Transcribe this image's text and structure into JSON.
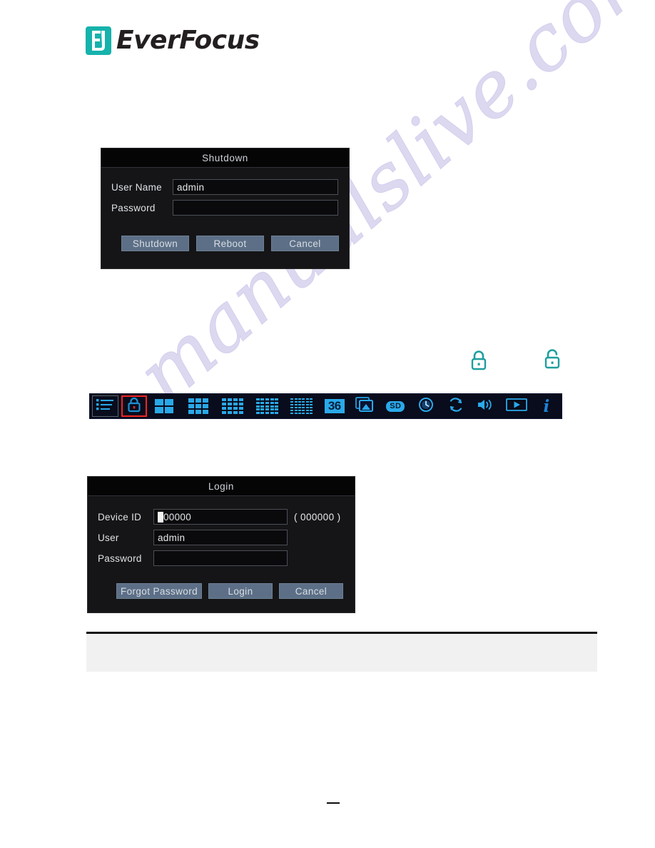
{
  "brand": {
    "name": "EverFocus",
    "logo_icon": "everfocus-f-mark",
    "accent_color": "#16b2ac",
    "text_color": "#231f20"
  },
  "watermark": {
    "text": "manualslive.com",
    "color": "#d7d2ee"
  },
  "shutdown_dialog": {
    "title": "Shutdown",
    "fields": [
      {
        "label": "User Name",
        "value": "admin",
        "placeholder": ""
      },
      {
        "label": "Password",
        "value": "",
        "placeholder": ""
      }
    ],
    "buttons": [
      {
        "label": "Shutdown"
      },
      {
        "label": "Reboot"
      },
      {
        "label": "Cancel"
      }
    ]
  },
  "login_dialog": {
    "title": "Login",
    "device_id": {
      "label": "Device ID",
      "value": "00000",
      "hint": "( 000000 )"
    },
    "fields": [
      {
        "label": "User",
        "value": "admin",
        "placeholder": ""
      },
      {
        "label": "Password",
        "value": "",
        "placeholder": ""
      }
    ],
    "buttons": [
      {
        "label": "Forgot Password"
      },
      {
        "label": "Login"
      },
      {
        "label": "Cancel"
      }
    ]
  },
  "toolbar": {
    "accent_color": "#28a8e8",
    "highlight_color": "#ef2424",
    "items": [
      {
        "icon": "menu-list-icon",
        "label": ""
      },
      {
        "icon": "lock-icon",
        "label": "",
        "selected": true
      },
      {
        "icon": "grid-2x2-icon",
        "label": ""
      },
      {
        "icon": "grid-3x3-icon",
        "label": ""
      },
      {
        "icon": "grid-4x4-icon",
        "label": ""
      },
      {
        "icon": "grid-5x5-icon",
        "label": ""
      },
      {
        "icon": "grid-6x6-icon",
        "label": ""
      },
      {
        "icon": "channel-count-badge",
        "label": "36"
      },
      {
        "icon": "snapshot-icon",
        "label": ""
      },
      {
        "icon": "sd-card-badge",
        "label": "SD"
      },
      {
        "icon": "clock-icon",
        "label": ""
      },
      {
        "icon": "sequence-refresh-icon",
        "label": ""
      },
      {
        "icon": "volume-icon",
        "label": ""
      },
      {
        "icon": "playback-icon",
        "label": ""
      },
      {
        "icon": "info-icon",
        "label": "i"
      }
    ]
  },
  "lock_glyphs": [
    {
      "icon": "lock-closed-icon",
      "color": "#1f9e9e"
    },
    {
      "icon": "lock-open-icon",
      "color": "#1f9e9e"
    }
  ],
  "note_box": {
    "text": ""
  },
  "footer": {
    "marker": ""
  }
}
